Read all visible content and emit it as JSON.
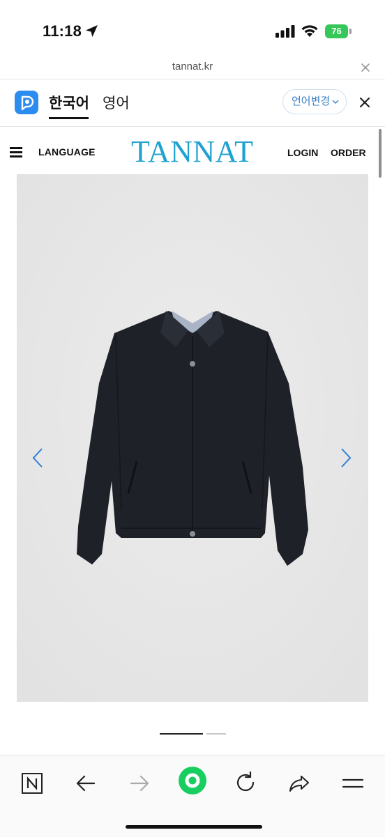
{
  "status_bar": {
    "time": "11:18",
    "battery_level": "76",
    "icons": [
      "location-arrow-icon",
      "signal-bars-icon",
      "wifi-icon",
      "battery-icon"
    ]
  },
  "browser": {
    "url": "tannat.kr"
  },
  "translate_bar": {
    "tabs": [
      {
        "label": "한국어",
        "active": true
      },
      {
        "label": "영어",
        "active": false
      }
    ],
    "change_language_label": "언어변경"
  },
  "site": {
    "menu_language": "LANGUAGE",
    "logo": "TANNAT",
    "login": "LOGIN",
    "order": "ORDER"
  },
  "carousel": {
    "slide_count": 2,
    "active_index": 0
  },
  "toolbar": {
    "icons": [
      "naver-n-icon",
      "back-arrow-icon",
      "forward-arrow-icon",
      "green-home-icon",
      "reload-icon",
      "share-icon",
      "menu-icon"
    ]
  },
  "colors": {
    "brand_blue": "#1fa2d0",
    "translate_accent": "#3a7fc4",
    "battery_green": "#35c759",
    "naver_green": "#19ce60",
    "photo_bg": "#e8e8e8",
    "jacket": "#1e2128"
  }
}
